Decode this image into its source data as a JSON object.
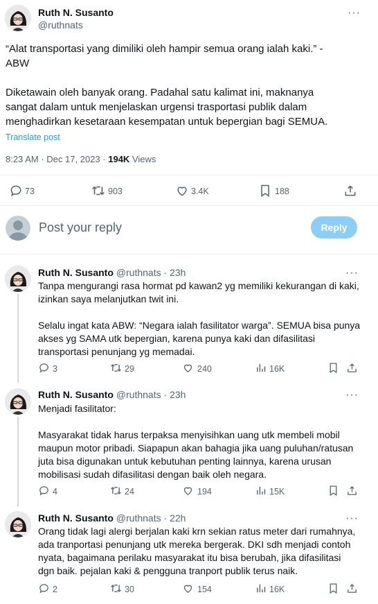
{
  "main_tweet": {
    "author_name": "Ruth N. Susanto",
    "author_handle": "@ruthnats",
    "more": "···",
    "text": "“Alat transportasi yang dimiliki oleh hampir semua orang ialah kaki.” -\nABW\n\nDiketawain oleh banyak orang. Padahal satu kalimat ini, maknanya\nsangat dalam untuk menjelaskan urgensi trasportasi publik dalam\nmenghadirkan kesetaraan kesempatan untuk bepergian bagi SEMUA.",
    "translate": "Translate post",
    "time": "8:23 AM",
    "dot": "·",
    "date": "Dec 17, 2023",
    "views_count": "194K",
    "views_label": "Views",
    "replies": "73",
    "retweets": "903",
    "likes": "3.4K",
    "bookmarks": "188"
  },
  "compose": {
    "placeholder": "Post your reply",
    "button": "Reply"
  },
  "replies": [
    {
      "author_name": "Ruth N. Susanto",
      "author_handle": "@ruthnats",
      "dot": "·",
      "time": "23h",
      "more": "···",
      "text": "Tanpa mengurangi rasa hormat pd kawan2 yg memiliki kekurangan di kaki,\nizinkan saya melanjutkan twit ini.\n\nSelalu ingat kata ABW: “Negara ialah fasilitator warga”. SEMUA bisa punya\nakses yg SAMA utk bepergian, karena punya kaki dan difasilitasi\ntransportasi penunjang yg memadai.",
      "replies": "3",
      "retweets": "29",
      "likes": "240",
      "views": "16K"
    },
    {
      "author_name": "Ruth N. Susanto",
      "author_handle": "@ruthnats",
      "dot": "·",
      "time": "23h",
      "more": "···",
      "text": "Menjadi fasilitator:\n\nMasyarakat tidak harus terpaksa menyisihkan uang utk membeli mobil\nmaupun motor pribadi. Siapapun akan bahagia jika uang puluhan/ratusan\njuta bisa digunakan untuk kebutuhan penting lainnya, karena urusan\nmobilisasi sudah difasilitasi dengan baik oleh negara.",
      "replies": "4",
      "retweets": "24",
      "likes": "194",
      "views": "15K"
    },
    {
      "author_name": "Ruth N. Susanto",
      "author_handle": "@ruthnats",
      "dot": "·",
      "time": "22h",
      "more": "···",
      "text": "Orang tidak lagi alergi berjalan kaki krn sekian ratus meter dari rumahnya,\nada tranportasi penunjang utk mereka bergerak. DKI sdh menjadi contoh\nnyata, bagaimana perilaku masyarakat itu bisa berubah, jika difasilitasi\ndgn baik. pejalan kaki & pengguna tranport publik terus naik.",
      "replies": "2",
      "retweets": "30",
      "likes": "154",
      "views": "16K"
    }
  ],
  "icons": {
    "reply": "reply-icon",
    "retweet": "retweet-icon",
    "like": "heart-icon",
    "views": "views-icon",
    "bookmark": "bookmark-icon",
    "share": "share-icon"
  },
  "colors": {
    "text": "#0f1419",
    "muted": "#536471",
    "link": "#1d9bf0",
    "reply_button": "#8ecdf7",
    "divider": "#eff3f4"
  }
}
